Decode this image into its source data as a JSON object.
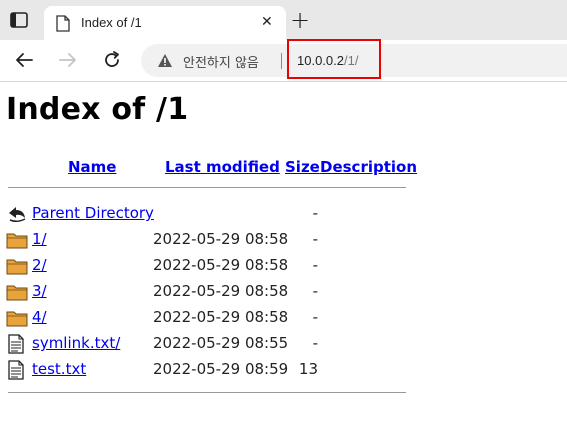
{
  "browser": {
    "tab_title": "Index of /1",
    "tab_close": "✕",
    "new_tab": "+",
    "security_text": "안전하지 않음",
    "url_host": "10.0.0.2",
    "url_path": "/1/"
  },
  "page": {
    "title": "Index of /1",
    "columns": {
      "name": "Name",
      "last_modified": "Last modified",
      "size": "Size",
      "description": "Description"
    },
    "entries": [
      {
        "icon": "back-arrow-icon",
        "name": "Parent Directory",
        "modified": "",
        "size": "-"
      },
      {
        "icon": "folder-icon",
        "name": "1/",
        "modified": "2022-05-29 08:58",
        "size": "-"
      },
      {
        "icon": "folder-icon",
        "name": "2/",
        "modified": "2022-05-29 08:58",
        "size": "-"
      },
      {
        "icon": "folder-icon",
        "name": "3/",
        "modified": "2022-05-29 08:58",
        "size": "-"
      },
      {
        "icon": "folder-icon",
        "name": "4/",
        "modified": "2022-05-29 08:58",
        "size": "-"
      },
      {
        "icon": "text-file-icon",
        "name": "symlink.txt/",
        "modified": "2022-05-29 08:55",
        "size": "-"
      },
      {
        "icon": "text-file-icon",
        "name": "test.txt",
        "modified": "2022-05-29 08:59",
        "size": "13"
      }
    ]
  },
  "colors": {
    "link": "#0000ee",
    "highlight": "#ee0000",
    "folder": "#e8a33a"
  }
}
